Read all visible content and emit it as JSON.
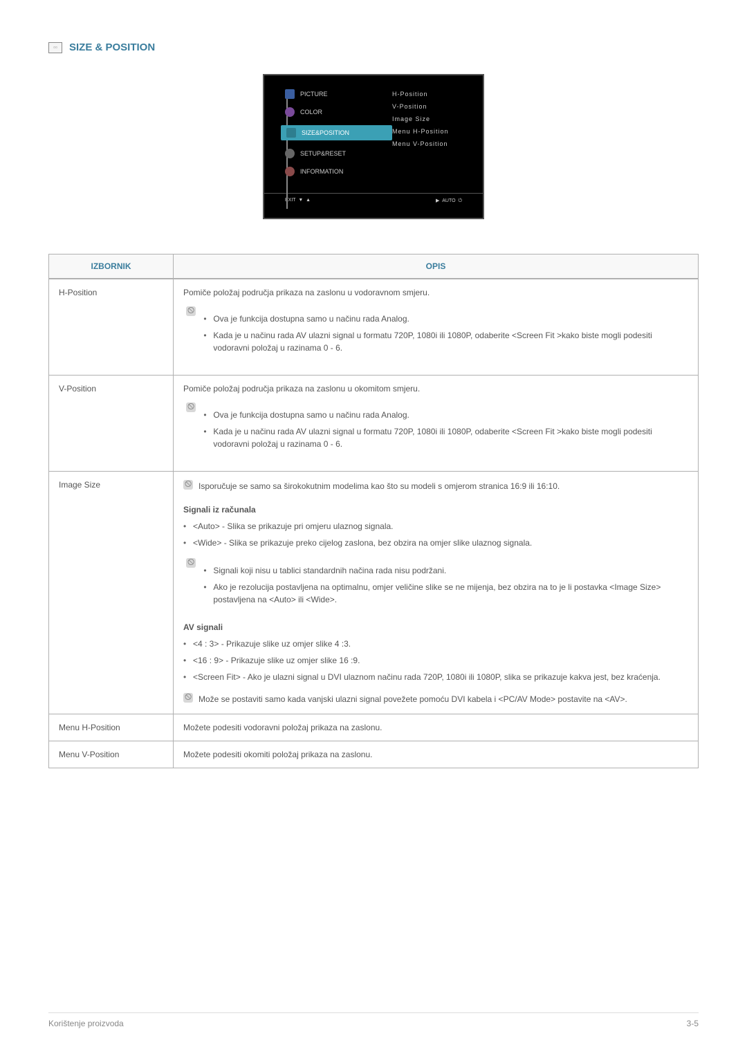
{
  "section": {
    "title": "SIZE & POSITION"
  },
  "osd": {
    "items": [
      "PICTURE",
      "COLOR",
      "SIZE&POSITION",
      "SETUP&RESET",
      "INFORMATION"
    ],
    "subitems": [
      "H-Position",
      "V-Position",
      "Image Size",
      "Menu H-Position",
      "Menu V-Position"
    ],
    "footer_left": "EXIT",
    "footer_right": "AUTO"
  },
  "table": {
    "headers": [
      "IZBORNIK",
      "OPIS"
    ],
    "rows": [
      {
        "menu": "H-Position",
        "desc": "Pomiče položaj područja prikaza na zaslonu u vodoravnom smjeru.",
        "note_items": [
          "Ova je funkcija dostupna samo u načinu rada Analog.",
          "Kada je u načinu rada AV ulazni signal u formatu 720P, 1080i ili 1080P, odaberite <Screen Fit >kako biste mogli podesiti vodoravni položaj u razinama 0 - 6."
        ]
      },
      {
        "menu": "V-Position",
        "desc": "Pomiče položaj područja prikaza na zaslonu u okomitom smjeru.",
        "note_items": [
          "Ova je funkcija dostupna samo u načinu rada Analog.",
          "Kada je u načinu rada AV ulazni signal u formatu 720P, 1080i ili 1080P, odaberite <Screen Fit >kako biste mogli podesiti vodoravni položaj u razinama 0 - 6."
        ]
      },
      {
        "menu": "Image Size",
        "top_note": "Isporučuje se samo sa širokokutnim modelima kao što su modeli s omjerom stranica 16:9 ili 16:10.",
        "sub1_title": "Signali iz računala",
        "sub1_list": [
          "<Auto> - Slika se prikazuje pri omjeru ulaznog signala.",
          "<Wide> - Slika se prikazuje preko cijelog zaslona, bez obzira na omjer slike ulaznog signala."
        ],
        "sub1_note_items": [
          "Signali koji nisu u tablici standardnih načina rada nisu podržani.",
          "Ako je rezolucija postavljena na optimalnu, omjer veličine slike se ne mijenja, bez obzira na to je li postavka <Image Size> postavljena na <Auto> ili <Wide>."
        ],
        "sub2_title": "AV signali",
        "sub2_list": [
          "<4 : 3> - Prikazuje slike uz omjer slike 4 :3.",
          "<16 : 9> - Prikazuje slike uz omjer slike 16 :9.",
          "<Screen Fit> - Ako je ulazni signal u DVI ulaznom načinu rada 720P, 1080i ili 1080P, slika se prikazuje kakva jest, bez kraćenja."
        ],
        "sub2_note": "Može se postaviti samo kada vanjski ulazni signal povežete pomoću DVI kabela i <PC/AV Mode> postavite na <AV>."
      },
      {
        "menu": "Menu H-Position",
        "desc": "Možete podesiti vodoravni položaj prikaza na zaslonu."
      },
      {
        "menu": "Menu V-Position",
        "desc": "Možete podesiti okomiti položaj prikaza na zaslonu."
      }
    ]
  },
  "footer": {
    "left": "Korištenje proizvoda",
    "right": "3-5"
  }
}
